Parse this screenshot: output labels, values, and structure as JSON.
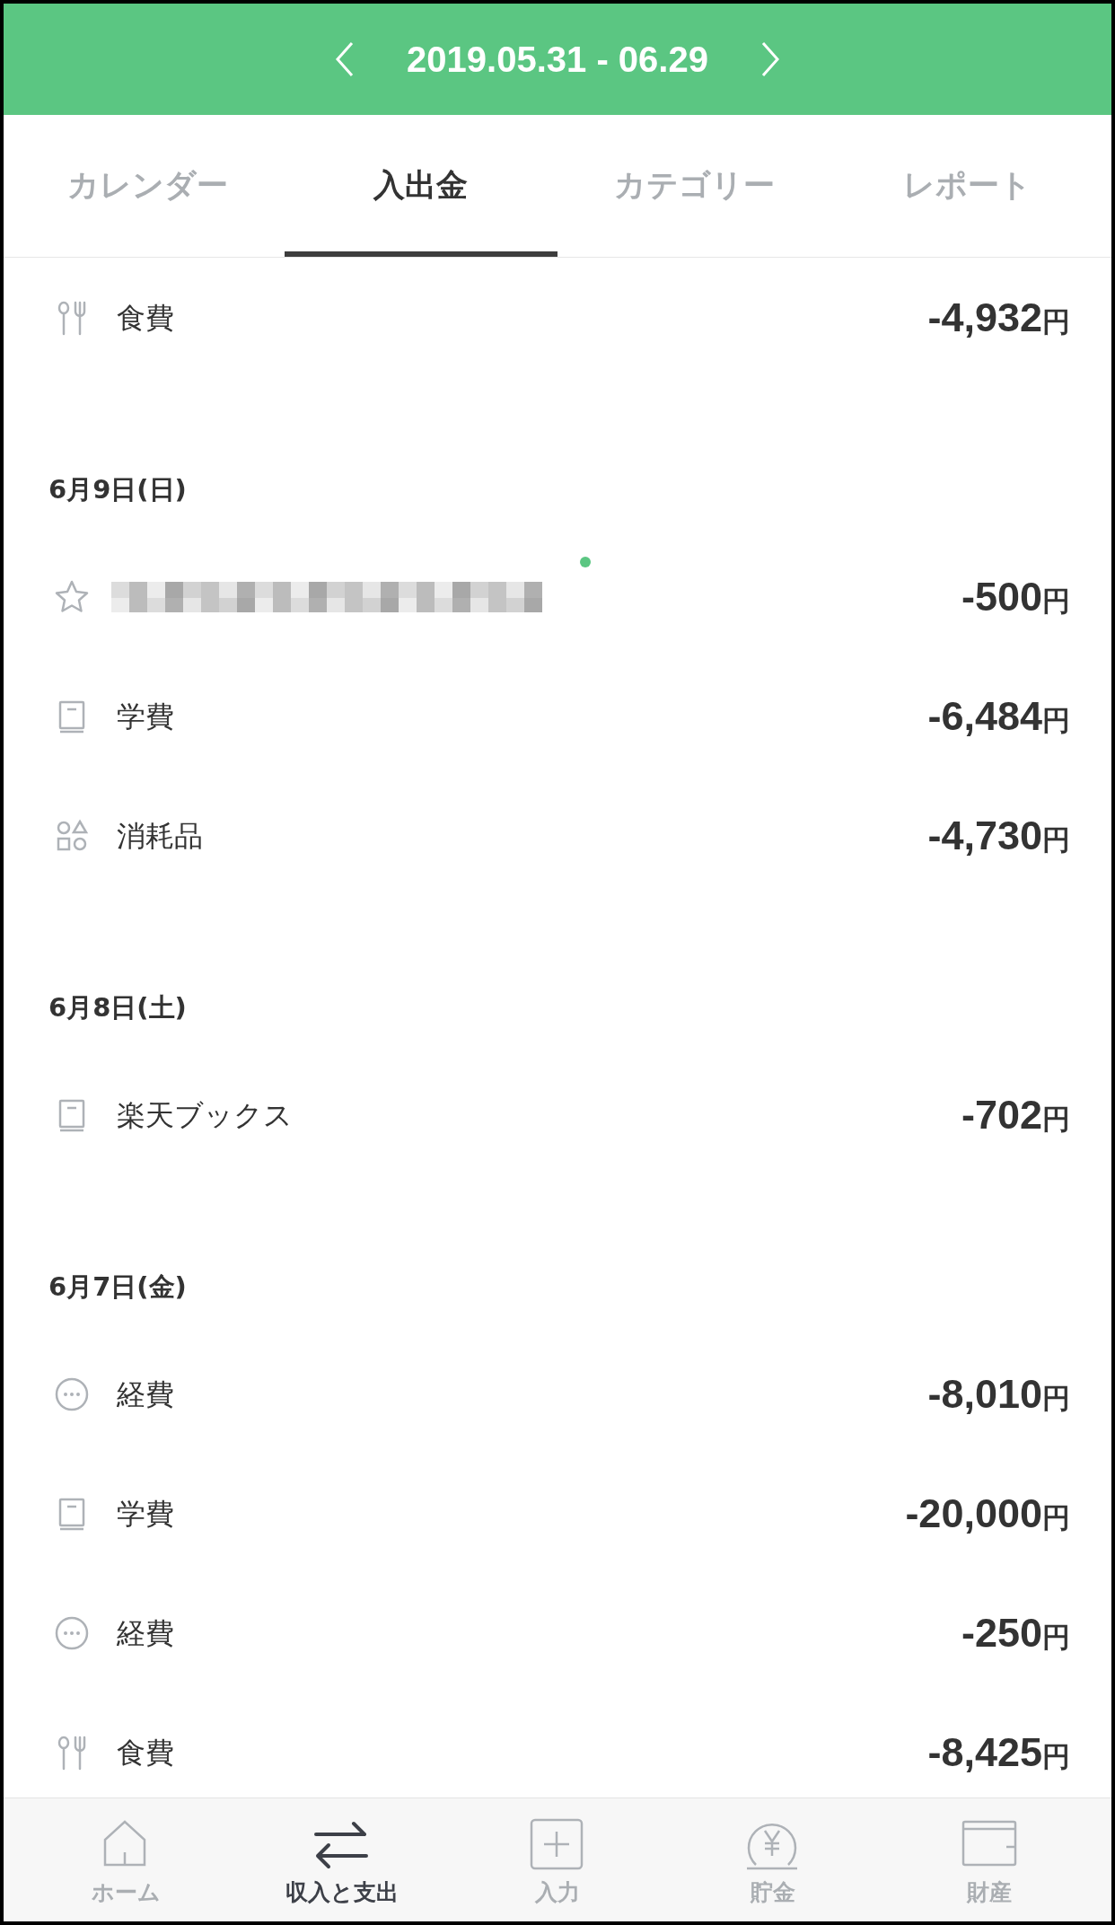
{
  "header": {
    "title": "2019.05.31 - 06.29"
  },
  "tabs": [
    {
      "label": "カレンダー",
      "selected": false
    },
    {
      "label": "入出金",
      "selected": true
    },
    {
      "label": "カテゴリー",
      "selected": false
    },
    {
      "label": "レポート",
      "selected": false
    }
  ],
  "sections": [
    {
      "entries": [
        {
          "kind": "food",
          "label": "食費",
          "amount": "-4,932",
          "currency": "円",
          "marked": false
        }
      ]
    },
    {
      "date": "6月9日(日)",
      "entries": [
        {
          "kind": "star",
          "redacted": true,
          "amount": "-500",
          "currency": "円",
          "marked": true
        },
        {
          "kind": "book",
          "label": "学費",
          "amount": "-6,484",
          "currency": "円",
          "marked": false
        },
        {
          "kind": "shapes",
          "label": "消耗品",
          "amount": "-4,730",
          "currency": "円",
          "marked": false
        }
      ]
    },
    {
      "date": "6月8日(土)",
      "entries": [
        {
          "kind": "book",
          "label": "楽天ブックス",
          "amount": "-702",
          "currency": "円",
          "marked": false
        }
      ]
    },
    {
      "date": "6月7日(金)",
      "entries": [
        {
          "kind": "other",
          "label": "経費",
          "amount": "-8,010",
          "currency": "円",
          "marked": false
        },
        {
          "kind": "book",
          "label": "学費",
          "amount": "-20,000",
          "currency": "円",
          "marked": false
        },
        {
          "kind": "other",
          "label": "経費",
          "amount": "-250",
          "currency": "円",
          "marked": false
        },
        {
          "kind": "food",
          "label": "食費",
          "amount": "-8,425",
          "currency": "円",
          "marked": false
        }
      ]
    }
  ],
  "bottom_nav": [
    {
      "kind": "home",
      "label": "ホーム",
      "selected": false
    },
    {
      "kind": "transfer",
      "label": "収入と支出",
      "selected": true
    },
    {
      "kind": "add",
      "label": "入力",
      "selected": false
    },
    {
      "kind": "savings",
      "label": "貯金",
      "selected": false
    },
    {
      "kind": "wallet",
      "label": "財産",
      "selected": false
    }
  ]
}
